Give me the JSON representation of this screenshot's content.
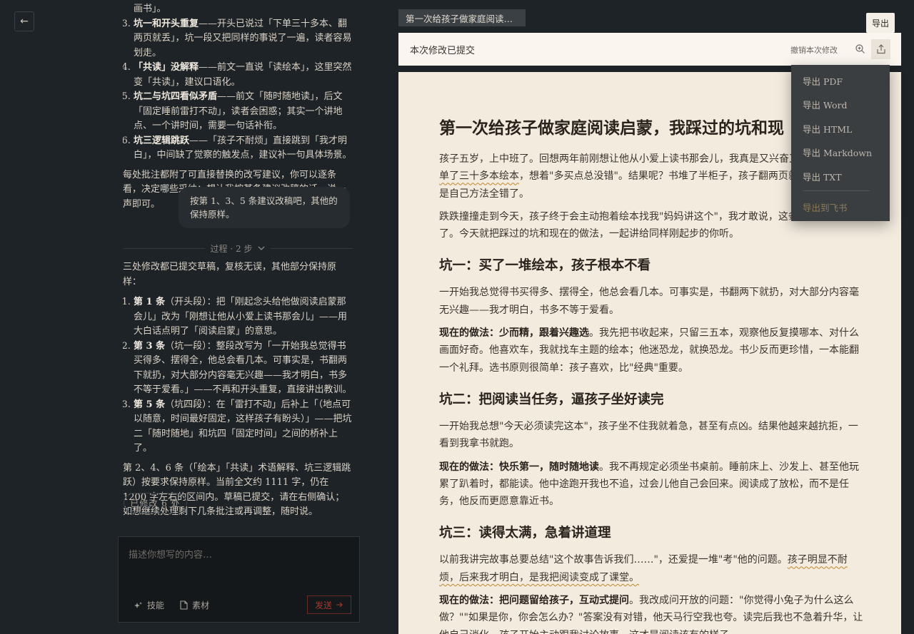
{
  "nav": {
    "back_icon": "arrow-left-icon",
    "back_glyph": "←"
  },
  "chat": {
    "top_fragment": "画书」。",
    "list1": [
      {
        "num": "3.",
        "bold": "坑一和开头重复",
        "text": "——开头已说过「下单三十多本、翻两页就丢」，坑一段又把同样的事说了一遍，读者容易划走。"
      },
      {
        "num": "4.",
        "bold": "「共读」没解释",
        "text": "——前文一直说「读绘本」，这里突然变「共读」，建议口语化。"
      },
      {
        "num": "5.",
        "bold": "坑二与坑四看似矛盾",
        "text": "——前文「随时随地读」，后文「固定睡前雷打不动」，读者会困惑；其实一个讲地点、一个讲时间，需要一句话补衔。"
      },
      {
        "num": "6.",
        "bold": "坑三逻辑跳跃",
        "text": "——「孩子不耐烦」直接跳到「我才明白」，中间缺了觉察的触发点，建议补一句具体场景。"
      }
    ],
    "para1": "每处批注都附了可直接替换的改写建议，你可以逐条看，决定哪些采纳；想让我按某条建议改稿的话，说一声即可。",
    "user_message": "按第 1、3、5 条建议改稿吧，其他的保持原样。",
    "process_label": "过程 · 2 步",
    "process_icon": "chevron-down-icon",
    "para2": "三处修改都已提交草稿，复核无误，其他部分保持原样：",
    "list2": [
      {
        "num": "1.",
        "bold": "第 1 条",
        "text": "（开头段）：把「刚起念头给他做阅读启蒙那会儿」改为「刚想让他从小爱上读书那会儿」——用大白话点明了「阅读启蒙」的意思。"
      },
      {
        "num": "2.",
        "bold": "第 3 条",
        "text": "（坑一段）：整段改写为「一开始我总觉得书买得多、摆得全，他总会看几本。可事实是，书翻两下就扔，对大部分内容毫无兴趣——我才明白，书多不等于爱看。」——不再和开头重复，直接讲出教训。"
      },
      {
        "num": "3.",
        "bold": "第 5 条",
        "text": "（坑四段）：在「雷打不动」后补上「（地点可以随意，时间最好固定，这样孩子有盼头）」——把坑二「随时随地」和坑四「固定时间」之间的桥补上了。"
      }
    ],
    "para3": "第 2、4、6 条（「绘本」「共读」术语解释、坑三逻辑跳跃）按要求保持原样。当前全文约 1111 字，仍在 1200 字左右的区间内。草稿已提交，请在右侧确认；如想继续处理剩下几条批注或再调整，随时说。",
    "modified_badge": "已修改  6  处"
  },
  "composer": {
    "placeholder": "描述你想写的内容…",
    "skills_label": "技能",
    "skills_icon": "sparkle-icon",
    "materials_label": "素材",
    "materials_icon": "file-icon",
    "send_label": "发送",
    "send_icon": "arrow-right-icon"
  },
  "document": {
    "tab_title": "第一次给孩子做家庭阅读启…",
    "status": "本次修改已提交",
    "revert_label": "撤销本次修改",
    "zoom_icon": "zoom-in-icon",
    "export_icon": "share-icon",
    "export_tooltip": "导出",
    "title": "第一次给孩子做家庭阅读启蒙，我踩过的坑和现",
    "p1a": "孩子五岁，上中班了。回想两年前刚想让他从小爱上读书那会儿，我真是又兴奋又手忙",
    "p1b": "单了三十多本绘本",
    "p1c": "，想着\"多买点总没错\"。结果呢？书堆了半柜子，孩子翻两页就丢开，",
    "p1d": "是自己方法全错了。",
    "p2": "跌跌撞撞走到今天，孩子终于会主动抱着绘本找我\"妈妈讲这个\"，我才敢说，这条路我算是",
    "p2b": "了。今天就把踩过的坑和现在的做法，一起讲给同样刚起步的你听。",
    "h_pit1": "坑一：买了一堆绘本，孩子根本不看",
    "pit1_p1": "一开始我总觉得书买得多、摆得全，他总会看几本。可事实是，书翻两下就扔，对大部分内容毫无兴趣——我才明白，书多不等于爱看。",
    "pit1_bold": "现在的做法：少而精，跟着兴趣选",
    "pit1_p2": "。我先把书收起来，只留三五本，观察他反复摸哪本、对什么画面好奇。他喜欢车，我就找车主题的绘本；他迷恐龙，就换恐龙。书少反而更珍惜，一本能翻一个礼拜。选书原则很简单：孩子喜欢，比\"经典\"重要。",
    "h_pit2": "坑二：把阅读当任务，逼孩子坐好读完",
    "pit2_p1": "一开始我总想\"今天必须读完这本\"，孩子坐不住我就着急，甚至有点凶。结果他越来越抗拒，一看到我拿书就跑。",
    "pit2_bold": "现在的做法：快乐第一，随时随地读",
    "pit2_p2": "。我不再规定必须坐书桌前。睡前床上、沙发上、甚至他玩累了趴着时，都能读。他中途跑开我也不追，过会儿他自己会回来。阅读成了放松，而不是任务，他反而更愿意靠近书。",
    "h_pit3": "坑三：读得太满，急着讲道理",
    "pit3_p1a": "以前我讲完故事总要总结\"这个故事告诉我们……\"，还爱提一堆\"考\"他的问题。",
    "pit3_p1b": "孩子明显不耐烦，后来我才明白，是我把阅读变成了课堂。",
    "pit3_bold": "现在的做法：把问题留给孩子，互动式提问",
    "pit3_p2": "。我改成问开放的问题：\"你觉得小兔子为什么这么做？\"\"如果是你，你会怎么办？\"答案没有对错，他天马行空我也夸。读完后我也不急着升华，让他自己消化。孩子开始主动跟我讨论故事，这才是阅读该有的样子。"
  },
  "export_menu": {
    "items": [
      "导出 PDF",
      "导出 Word",
      "导出 HTML",
      "导出 Markdown",
      "导出 TXT"
    ],
    "feishu": "导出到飞书"
  }
}
